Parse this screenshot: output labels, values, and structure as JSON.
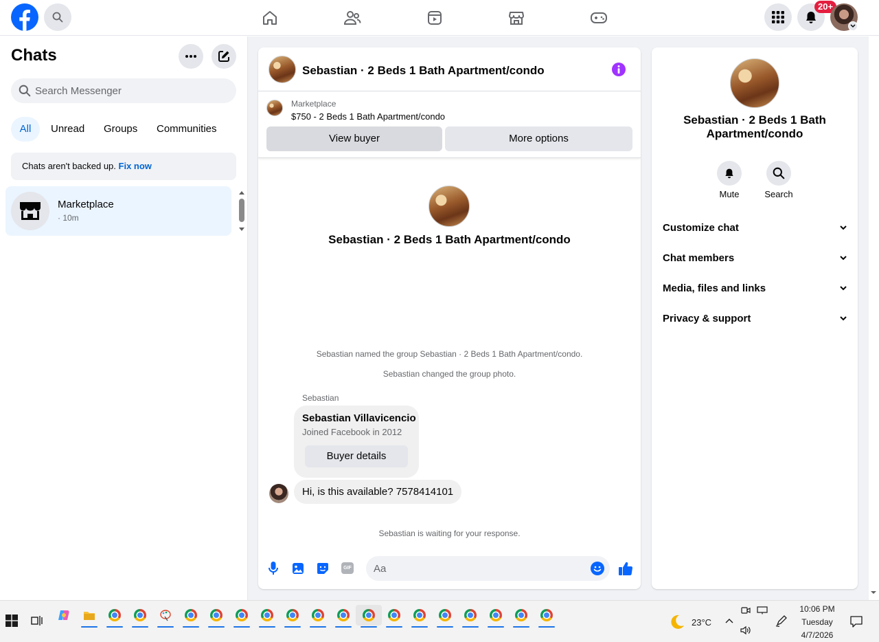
{
  "topbar": {
    "notification_badge": "20+",
    "search_icon": "search-icon",
    "nav_icons": [
      "home-icon",
      "friends-icon",
      "video-icon",
      "marketplace-icon",
      "gaming-icon"
    ],
    "brand_color": "#0866ff",
    "badge_color": "#e41e3f"
  },
  "left": {
    "title": "Chats",
    "search_placeholder": "Search Messenger",
    "filters": [
      "All",
      "Unread",
      "Groups",
      "Communities"
    ],
    "backup_text": "Chats aren't backed up.",
    "backup_link": "Fix now",
    "chat_item": {
      "name": "Marketplace",
      "time": "· 10m"
    }
  },
  "center": {
    "header_title": "Sebastian · 2 Beds 1 Bath Apartment/condo",
    "listing_label": "Marketplace",
    "listing_title": "$750 - 2 Beds 1 Bath Apartment/condo",
    "view_buyer": "View buyer",
    "more_options": "More options",
    "profile_name": "Sebastian · 2 Beds 1 Bath Apartment/condo",
    "sys_named": "Sebastian named the group Sebastian · 2 Beds 1 Bath Apartment/condo.",
    "sys_photo": "Sebastian changed the group photo.",
    "sender": "Sebastian",
    "card_name": "Sebastian Villavicencio",
    "card_sub": "Joined Facebook in 2012",
    "buyer_details": "Buyer details",
    "message": "Hi, is this available? 7578414101",
    "waiting": "Sebastian is waiting for your response.",
    "composer_placeholder": "Aa",
    "accent_color": "#0866ff"
  },
  "right": {
    "name": "Sebastian · 2 Beds 1 Bath Apartment/condo",
    "mute": "Mute",
    "search": "Search",
    "sections": [
      "Customize chat",
      "Chat members",
      "Media, files and links",
      "Privacy & support"
    ]
  },
  "taskbar": {
    "temperature": "23°C",
    "time": "10:06 PM",
    "day": "Tuesday",
    "date": "4/7/2026"
  }
}
